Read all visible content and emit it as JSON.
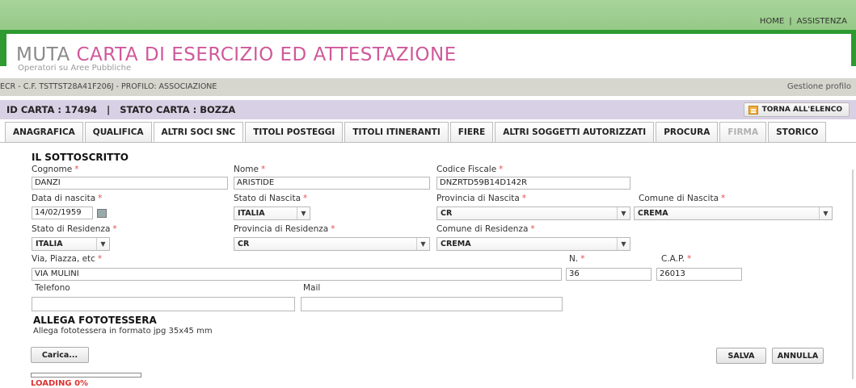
{
  "header": {
    "links": [
      "HOME",
      "|",
      "ASSISTENZA"
    ]
  },
  "app": {
    "title_a": "MUTA",
    "title_b": "CARTA DI ESERCIZIO ED ATTESTAZIONE",
    "subtitle": "Operatori su Aree Pubbliche"
  },
  "infobar": {
    "user": "ECR - C.F. TSTTST28A41F206J - PROFILO: ASSOCIAZIONE",
    "profile_link": "Gestione profilo"
  },
  "idbar": {
    "text": "ID CARTA : 17494   |   STATO CARTA : BOZZA",
    "back_label": "TORNA ALL'ELENCO"
  },
  "tabs": [
    "ANAGRAFICA",
    "QUALIFICA",
    "ALTRI SOCI SNC",
    "TITOLI POSTEGGI",
    "TITOLI ITINERANTI",
    "FIERE",
    "ALTRI SOGGETTI AUTORIZZATI",
    "PROCURA",
    "FIRMA",
    "STORICO"
  ],
  "form": {
    "section": "IL SOTTOSCRITTO",
    "cognome_label": "Cognome",
    "cognome": "DANZI",
    "nome_label": "Nome",
    "nome": "ARISTIDE",
    "cf_label": "Codice Fiscale",
    "cf": "DNZRTD59B14D142R",
    "nascita_label": "Data di nascita",
    "nascita": "14/02/1959",
    "stato_nascita_label": "Stato di Nascita",
    "stato_nascita": "ITALIA",
    "prov_nascita_label": "Provincia di Nascita",
    "prov_nascita": "CR",
    "comune_nascita_label": "Comune di Nascita",
    "comune_nascita": "CREMA",
    "stato_res_label": "Stato di Residenza",
    "stato_res": "ITALIA",
    "prov_res_label": "Provincia di Residenza",
    "prov_res": "CR",
    "comune_res_label": "Comune di Residenza",
    "comune_res": "CREMA",
    "via_label": "Via, Piazza, etc",
    "via": "VIA MULINI",
    "n_label": "N.",
    "n": "36",
    "cap_label": "C.A.P.",
    "cap": "26013",
    "tel_label": "Telefono",
    "tel": "",
    "mail_label": "Mail",
    "mail": "",
    "required_mark": "*"
  },
  "foto": {
    "section": "ALLEGA FOTOTESSERA",
    "hint": "Allega fototessera in formato jpg 35x45 mm",
    "upload_label": "Carica..."
  },
  "actions": {
    "save": "SALVA",
    "cancel": "ANNULLA"
  },
  "progress": {
    "text": "LOADING 0%",
    "value": 0
  },
  "colors": {
    "green": "#2f9a2f",
    "pink": "#d0589a",
    "required": "#e05050"
  }
}
